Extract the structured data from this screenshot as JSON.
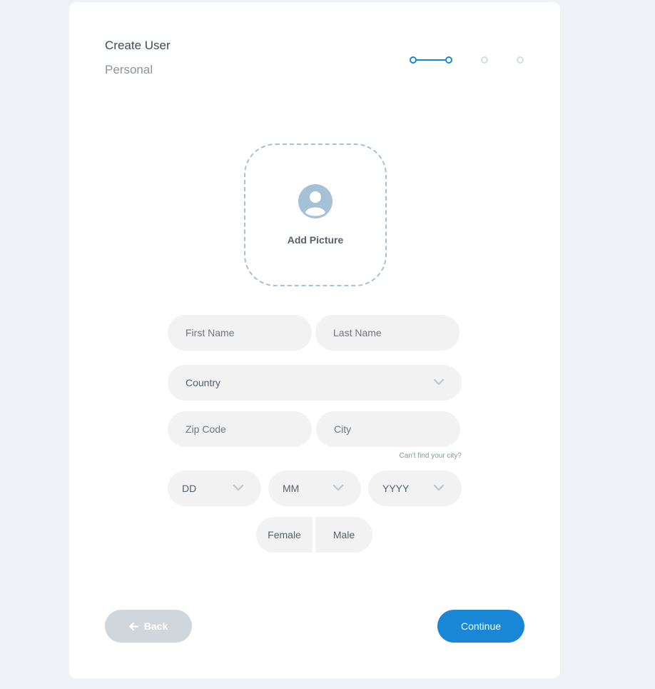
{
  "header": {
    "title": "Create User",
    "subtitle": "Personal"
  },
  "stepper": {
    "current_step": 1,
    "total_steps": 3
  },
  "avatar": {
    "label": "Add Picture",
    "icon": "user-avatar-icon"
  },
  "form": {
    "first_name": {
      "placeholder": "First Name",
      "value": ""
    },
    "last_name": {
      "placeholder": "Last Name",
      "value": ""
    },
    "country": {
      "placeholder": "Country"
    },
    "zip": {
      "placeholder": "Zip Code",
      "value": ""
    },
    "city": {
      "placeholder": "City",
      "value": ""
    },
    "city_hint": "Can't find your city?",
    "dob": {
      "day": "DD",
      "month": "MM",
      "year": "YYYY"
    },
    "gender": {
      "female": "Female",
      "male": "Male"
    }
  },
  "footer": {
    "back_label": "Back",
    "continue_label": "Continue"
  },
  "colors": {
    "accent": "#1a86d6",
    "background": "#eef2f6",
    "field_bg": "#f2f2f2",
    "back_button": "#d0d7dc"
  }
}
